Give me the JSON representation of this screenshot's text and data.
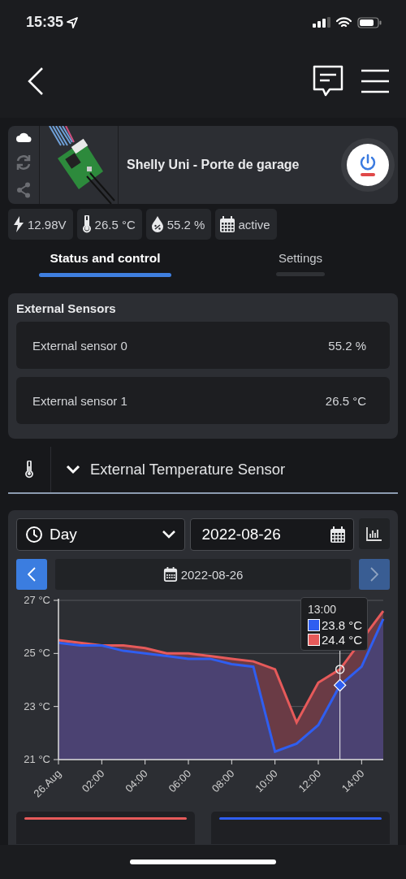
{
  "status_bar": {
    "time": "15:35"
  },
  "device": {
    "name": "Shelly Uni - Porte de garage",
    "cloud_connected": true
  },
  "chips": [
    {
      "kind": "voltage",
      "text": "12.98V"
    },
    {
      "kind": "temperature",
      "text": "26.5 °C"
    },
    {
      "kind": "humidity",
      "text": "55.2 %"
    },
    {
      "kind": "schedule",
      "text": "active"
    }
  ],
  "tabs": [
    {
      "label": "Status and control",
      "selected": true
    },
    {
      "label": "Settings",
      "selected": false
    }
  ],
  "external_sensors": {
    "title": "External Sensors",
    "rows": [
      {
        "name": "External sensor 0",
        "value": "55.2 %"
      },
      {
        "name": "External sensor 1",
        "value": "26.5 °C"
      }
    ]
  },
  "sensor_header": {
    "title": "External Temperature Sensor",
    "expanded": true
  },
  "history": {
    "period": "Day",
    "date": "2022-08-26",
    "nav_date": "2022-08-26",
    "prev_disabled": false,
    "next_disabled": true,
    "chart_data": {
      "type": "area",
      "x": [
        0,
        1,
        2,
        3,
        4,
        5,
        6,
        7,
        8,
        9,
        10,
        11,
        12,
        13,
        14,
        15
      ],
      "series": [
        {
          "color": "#e65a5a",
          "values": [
            25.5,
            25.4,
            25.3,
            25.3,
            25.2,
            25.0,
            25.0,
            24.9,
            24.8,
            24.7,
            24.4,
            22.4,
            23.9,
            24.4,
            null,
            26.6
          ]
        },
        {
          "color": "#2f5ef0",
          "values": [
            25.4,
            25.3,
            25.3,
            25.1,
            25.0,
            24.9,
            24.8,
            24.8,
            24.6,
            24.5,
            21.3,
            21.6,
            22.3,
            23.8,
            24.5,
            26.3
          ]
        }
      ],
      "xlim": [
        0,
        15
      ],
      "ylim": [
        21,
        27
      ],
      "xticks": [
        {
          "value": 0,
          "label": "26.Aug"
        },
        {
          "value": 2,
          "label": "02:00"
        },
        {
          "value": 4,
          "label": "04:00"
        },
        {
          "value": 6,
          "label": "06:00"
        },
        {
          "value": 8,
          "label": "08:00"
        },
        {
          "value": 10,
          "label": "10:00"
        },
        {
          "value": 12,
          "label": "12:00"
        },
        {
          "value": 14,
          "label": "14:00"
        }
      ],
      "yticks": [
        {
          "value": 21,
          "label": "21 °C"
        },
        {
          "value": 23,
          "label": "23 °C"
        },
        {
          "value": 25,
          "label": "25 °C"
        },
        {
          "value": 27,
          "label": "27 °C"
        }
      ],
      "ref_lines": [
        {
          "axis": "x",
          "value": 13
        }
      ]
    },
    "tooltip": {
      "time": "13:00",
      "entries": [
        {
          "color": "#2f5ef0",
          "value": "23.8 °C"
        },
        {
          "color": "#e65a5a",
          "value": "24.4 °C"
        }
      ]
    }
  }
}
